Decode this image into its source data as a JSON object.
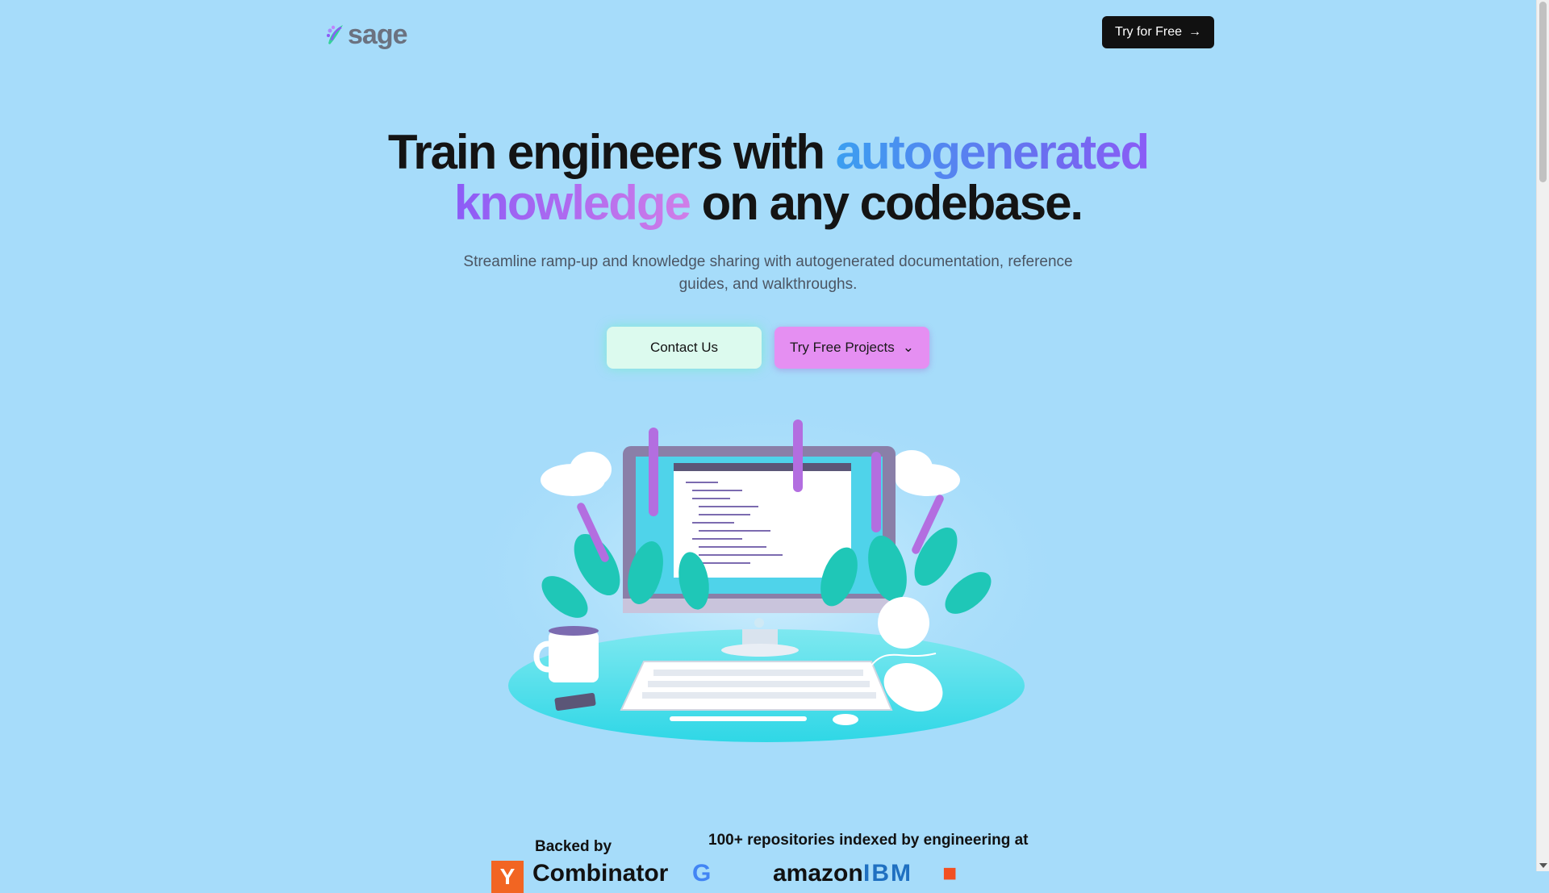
{
  "header": {
    "logo_text": "sage",
    "try_free_label": "Try for Free"
  },
  "hero": {
    "headline_part1": "Train engineers with ",
    "headline_highlight1": "autogenerated",
    "headline_highlight2": "knowledge",
    "headline_part2": " on any codebase.",
    "subhead": "Streamline ramp-up and knowledge sharing with autogenerated documentation, reference guides, and walkthroughs.",
    "contact_label": "Contact Us",
    "projects_label": "Try Free Projects"
  },
  "footer_strip": {
    "backed_by": "Backed by",
    "backer_name": "Combinator",
    "indexed_text": "100+ repositories indexed by engineering at",
    "companies": [
      "amazon",
      "IBM"
    ]
  },
  "colors": {
    "background": "#a6dcfa",
    "accent_purple": "#8b5cf6",
    "button_dark": "#111111",
    "button_mint": "#dcfaee",
    "button_pink": "#e58ff2"
  }
}
